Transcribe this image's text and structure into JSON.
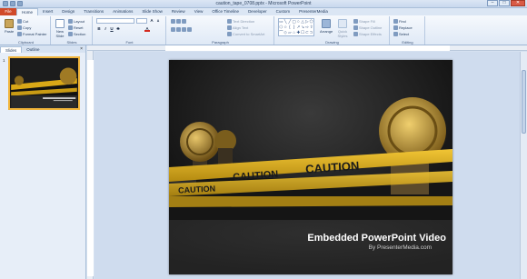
{
  "window": {
    "title": "caution_tape_0708.pptx - Microsoft PowerPoint",
    "minimize": "–",
    "maximize": "□",
    "close": "✕"
  },
  "tabs": {
    "file": "File",
    "items": [
      "Home",
      "Insert",
      "Design",
      "Transitions",
      "Animations",
      "Slide Show",
      "Review",
      "View",
      "Office Timeline",
      "Developer",
      "Custom",
      "PresenterMedia"
    ]
  },
  "ribbon": {
    "clipboard": {
      "paste": "Paste",
      "cut": "Cut",
      "copy": "Copy",
      "format_painter": "Format Painter",
      "label": "Clipboard"
    },
    "slides": {
      "new_slide": "New Slide",
      "layout": "Layout",
      "reset": "Reset",
      "section": "Section",
      "label": "Slides"
    },
    "font": {
      "label": "Font",
      "bold": "B",
      "italic": "I",
      "underline": "U",
      "strike": "S"
    },
    "paragraph": {
      "text_direction": "Text Direction",
      "align_text": "Align Text",
      "convert_smartart": "Convert to SmartArt",
      "label": "Paragraph"
    },
    "drawing": {
      "arrange": "Arrange",
      "quick_styles": "Quick Styles",
      "shape_fill": "Shape Fill",
      "shape_outline": "Shape Outline",
      "shape_effects": "Shape Effects",
      "label": "Drawing"
    },
    "editing": {
      "find": "Find",
      "replace": "Replace",
      "select": "Select",
      "label": "Editing"
    }
  },
  "panel": {
    "tab_slides": "Slides",
    "tab_outline": "Outline",
    "close": "×",
    "slide_number": "1"
  },
  "slide": {
    "title": "Embedded PowerPoint Video",
    "subtitle": "By PresenterMedia.com",
    "tape_text": "CAUTION"
  },
  "colors": {
    "file_tab": "#d04a2a",
    "tape_yellow": "#e3b21a",
    "selection": "#f1b53b"
  }
}
